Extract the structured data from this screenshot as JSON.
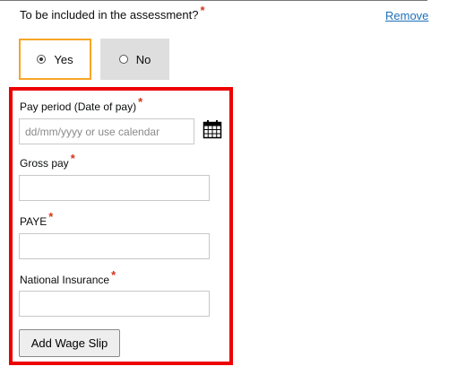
{
  "question": {
    "label": "To be included in the assessment?",
    "required_mark": "*"
  },
  "remove_link": "Remove",
  "choices": [
    {
      "label": "Yes",
      "selected": true
    },
    {
      "label": "No",
      "selected": false
    }
  ],
  "wage_slip": {
    "pay_period": {
      "label": "Pay period (Date of pay)",
      "required_mark": "*",
      "placeholder": "dd/mm/yyyy or use calendar",
      "icon": "calendar-icon"
    },
    "gross_pay": {
      "label": "Gross pay",
      "required_mark": "*",
      "value": ""
    },
    "paye": {
      "label": "PAYE",
      "required_mark": "*",
      "value": ""
    },
    "national_insurance": {
      "label": "National Insurance",
      "required_mark": "*",
      "value": ""
    },
    "add_button": "Add Wage Slip"
  },
  "colors": {
    "panel_border": "#ee0000",
    "focus_border": "#f7a526",
    "link": "#1d70b8",
    "required": "#d4351c"
  }
}
